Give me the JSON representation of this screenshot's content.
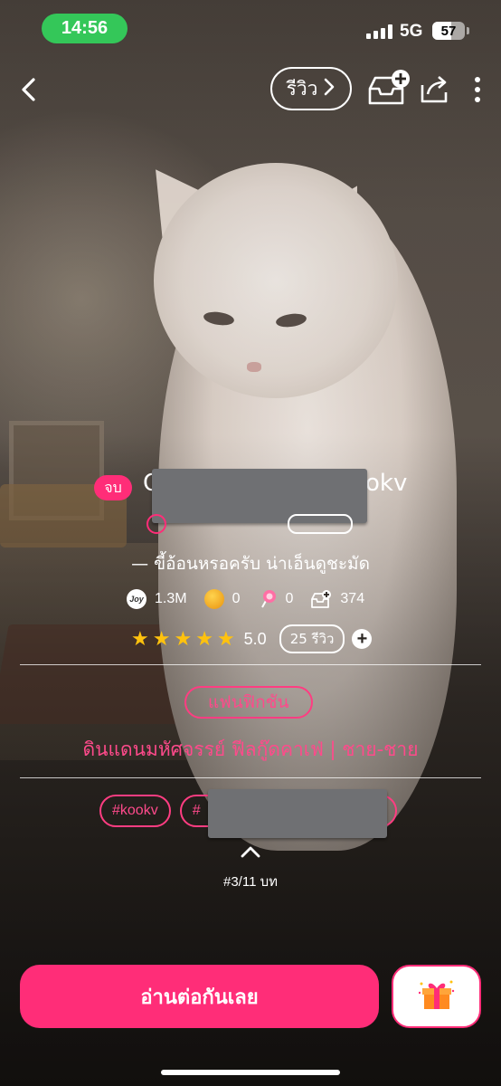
{
  "status_bar": {
    "time": "14:56",
    "network": "5G",
    "battery": "57",
    "battery_level": 0.57
  },
  "nav": {
    "review_label": "รีวิว"
  },
  "story": {
    "status_badge": "จบ",
    "title_start": "C",
    "title_end": "okv",
    "subtitle": "— ขี้อ้อนหรอครับ น่าเอ็นดูชะมัด",
    "stats": {
      "joy": "1.3M",
      "joy_icon_label": "Joy",
      "coins": "0",
      "candy": "0",
      "library_adds": "374"
    },
    "rating": {
      "value": "5.0",
      "stars": 5,
      "reviews_label": "25 รีวิว"
    },
    "category": "แฟนฟิกชัน",
    "genres": "ดินแดนมหัศจรรย์  ฟีลกู๊ดคาเฟ่  |  ชาย-ชาย",
    "hashtags": [
      "#kookv",
      "#"
    ],
    "chapter_progress": "#3/11 บท"
  },
  "actions": {
    "read_button": "อ่านต่อกันเลย"
  },
  "colors": {
    "accent": "#ff2d78",
    "status_green": "#34c759",
    "star": "#ffc20e",
    "mask": "#6f7073"
  },
  "icons": [
    "back-icon",
    "chevron-right-icon",
    "add-to-library-icon",
    "share-icon",
    "more-icon",
    "joy-icon",
    "coin-icon",
    "candy-icon",
    "library-icon",
    "star-icon",
    "plus-icon",
    "chevron-up-icon",
    "gift-icon"
  ]
}
